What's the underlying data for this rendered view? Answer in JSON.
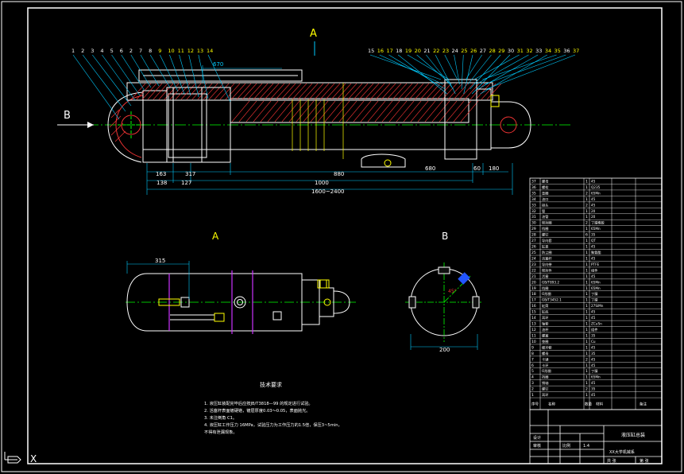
{
  "views": {
    "section_a_marker": "A",
    "section_b_marker": "B",
    "view_a_title": "A",
    "view_b_title": "B"
  },
  "main_dims": {
    "top_dim": "670",
    "d1": "163",
    "d2": "317",
    "d3": "880",
    "d4": "680",
    "d5": "60",
    "d6": "180",
    "d7": "138",
    "d8": "127",
    "d9": "1000",
    "d10": "1600~2400"
  },
  "view_a_dim": "315",
  "view_b_dim": "200",
  "view_b_angle": "45°",
  "left_callouts": [
    "1",
    "2",
    "3",
    "4",
    "5",
    "6",
    "2",
    "7",
    "8",
    "9",
    "10",
    "11",
    "12",
    "13",
    "14"
  ],
  "right_callouts": [
    "15",
    "16",
    "17",
    "18",
    "19",
    "20",
    "21",
    "22",
    "23",
    "24",
    "25",
    "26",
    "27",
    "28",
    "29",
    "30",
    "31",
    "32",
    "33",
    "34",
    "35",
    "36",
    "37"
  ],
  "notes": {
    "title": "技术要求",
    "items": [
      "1. 液压缸装配完毕后应按JB/T3818—99 的规定进行试验。",
      "2. 活塞杆表面镀硬铬，镀层厚度0.03～0.05，表面抛光。",
      "3. 未注倒角 C1。",
      "4. 液压缸工作压力 16MPa，试验压力为工作压力的1.5倍，保压3~5min，",
      "   不得有泄漏现象。"
    ]
  },
  "bom": {
    "rows": [
      {
        "no": "37",
        "name": "螺母",
        "qty": "1",
        "mat": "45"
      },
      {
        "no": "36",
        "name": "螺栓",
        "qty": "1",
        "mat": "Q235"
      },
      {
        "no": "35",
        "name": "垫圈",
        "qty": "2",
        "mat": "65Mn"
      },
      {
        "no": "34",
        "name": "油口",
        "qty": "1",
        "mat": "45"
      },
      {
        "no": "33",
        "name": "接头",
        "qty": "2",
        "mat": "45"
      },
      {
        "no": "32",
        "name": "管",
        "qty": "1",
        "mat": "20"
      },
      {
        "no": "31",
        "name": "油管",
        "qty": "1",
        "mat": "20"
      },
      {
        "no": "30",
        "name": "密封圈",
        "qty": "2",
        "mat": "丁腈橡胶"
      },
      {
        "no": "29",
        "name": "挡圈",
        "qty": "1",
        "mat": "65Mn"
      },
      {
        "no": "28",
        "name": "螺钉",
        "qty": "6",
        "mat": "35"
      },
      {
        "no": "27",
        "name": "导向套",
        "qty": "1",
        "mat": "QT"
      },
      {
        "no": "26",
        "name": "缸盖",
        "qty": "1",
        "mat": "45"
      },
      {
        "no": "25",
        "name": "防尘圈",
        "qty": "1",
        "mat": "聚氨酯"
      },
      {
        "no": "24",
        "name": "活塞杆",
        "qty": "1",
        "mat": "45"
      },
      {
        "no": "23",
        "name": "导向带",
        "qty": "1",
        "mat": "PTFE"
      },
      {
        "no": "22",
        "name": "密封件",
        "qty": "1",
        "mat": "组件"
      },
      {
        "no": "21",
        "name": "活塞",
        "qty": "1",
        "mat": "45"
      },
      {
        "no": "20",
        "name": "GB/T893.2",
        "qty": "1",
        "mat": "65Mn"
      },
      {
        "no": "19",
        "name": "挡圈",
        "qty": "1",
        "mat": "65Mn"
      },
      {
        "no": "18",
        "name": "O形圈",
        "qty": "1",
        "mat": "丁腈"
      },
      {
        "no": "17",
        "name": "GB/T3452.1",
        "qty": "1",
        "mat": "丁腈"
      },
      {
        "no": "16",
        "name": "缸筒",
        "qty": "1",
        "mat": "27SiMn"
      },
      {
        "no": "15",
        "name": "缸底",
        "qty": "1",
        "mat": "45"
      },
      {
        "no": "14",
        "name": "耳环",
        "qty": "1",
        "mat": "45"
      },
      {
        "no": "13",
        "name": "轴套",
        "qty": "1",
        "mat": "ZCuSn"
      },
      {
        "no": "12",
        "name": "油杯",
        "qty": "1",
        "mat": "组件"
      },
      {
        "no": "11",
        "name": "螺塞",
        "qty": "1",
        "mat": "35"
      },
      {
        "no": "10",
        "name": "垫圈",
        "qty": "1",
        "mat": "Cu"
      },
      {
        "no": "9",
        "name": "缓冲套",
        "qty": "1",
        "mat": "45"
      },
      {
        "no": "8",
        "name": "螺母",
        "qty": "1",
        "mat": "35"
      },
      {
        "no": "7",
        "name": "卡键",
        "qty": "2",
        "mat": "45"
      },
      {
        "no": "6",
        "name": "卡环",
        "qty": "1",
        "mat": "45"
      },
      {
        "no": "5",
        "name": "O形圈",
        "qty": "1",
        "mat": "丁腈"
      },
      {
        "no": "4",
        "name": "挡圈",
        "qty": "1",
        "mat": "65Mn"
      },
      {
        "no": "3",
        "name": "销轴",
        "qty": "1",
        "mat": "45"
      },
      {
        "no": "2",
        "name": "螺钉",
        "qty": "2",
        "mat": "35"
      },
      {
        "no": "1",
        "name": "耳环",
        "qty": "1",
        "mat": "45"
      }
    ],
    "header": {
      "no": "序号",
      "name": "名称",
      "qty": "数量",
      "mat": "材料",
      "remark": "备注"
    },
    "drawing_title": "液压缸总装",
    "school": "XX大学机械系",
    "fields": [
      "设计",
      "审核",
      "比例",
      "1:4",
      "共 张",
      "第 张"
    ]
  }
}
